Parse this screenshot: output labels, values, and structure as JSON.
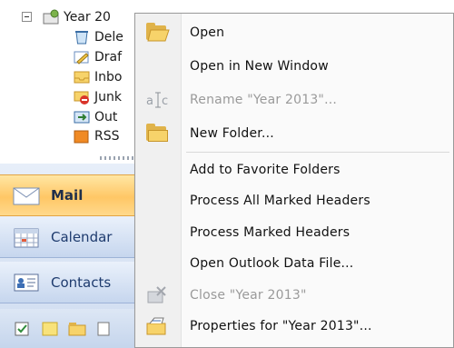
{
  "tree": {
    "root_label": "Year 20",
    "children": [
      "Dele",
      "Draf",
      "Inbo",
      "Junk",
      "Out",
      "RSS"
    ]
  },
  "nav": {
    "mail": "Mail",
    "calendar": "Calendar",
    "contacts": "Contacts"
  },
  "menu": {
    "open": "Open",
    "open_new_window": "Open in New Window",
    "rename": "Rename \"Year 2013\"...",
    "new_folder": "New Folder...",
    "add_favorites": "Add to Favorite Folders",
    "process_all": "Process All Marked Headers",
    "process_marked": "Process Marked Headers",
    "open_data_file": "Open Outlook Data File...",
    "close": "Close \"Year 2013\"",
    "properties": "Properties for \"Year 2013\"..."
  },
  "icons": {
    "open": "open-folder-icon",
    "rename": "rename-icon",
    "new_folder": "new-folder-icon",
    "close": "close-data-file-icon",
    "properties": "properties-icon"
  }
}
